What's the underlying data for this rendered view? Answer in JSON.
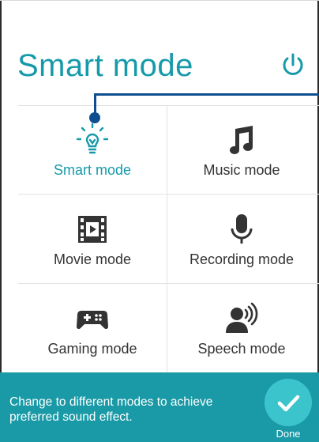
{
  "header": {
    "title": "Smart mode",
    "power_icon": "power-icon"
  },
  "modes": [
    {
      "id": "smart",
      "label": "Smart mode",
      "icon": "lightbulb-icon",
      "selected": true
    },
    {
      "id": "music",
      "label": "Music mode",
      "icon": "music-note-icon",
      "selected": false
    },
    {
      "id": "movie",
      "label": "Movie mode",
      "icon": "film-icon",
      "selected": false
    },
    {
      "id": "recording",
      "label": "Recording mode",
      "icon": "microphone-icon",
      "selected": false
    },
    {
      "id": "gaming",
      "label": "Gaming mode",
      "icon": "gamepad-icon",
      "selected": false
    },
    {
      "id": "speech",
      "label": "Speech mode",
      "icon": "speaking-person-icon",
      "selected": false
    }
  ],
  "footer": {
    "hint": "Change to different modes to achieve preferred sound effect.",
    "done_label": "Done"
  },
  "colors": {
    "accent": "#169aa9",
    "footer_bg": "#1a9aa6",
    "done_button": "#3cc4cd",
    "callout": "#0e4e8f",
    "icon_dark": "#333333"
  }
}
